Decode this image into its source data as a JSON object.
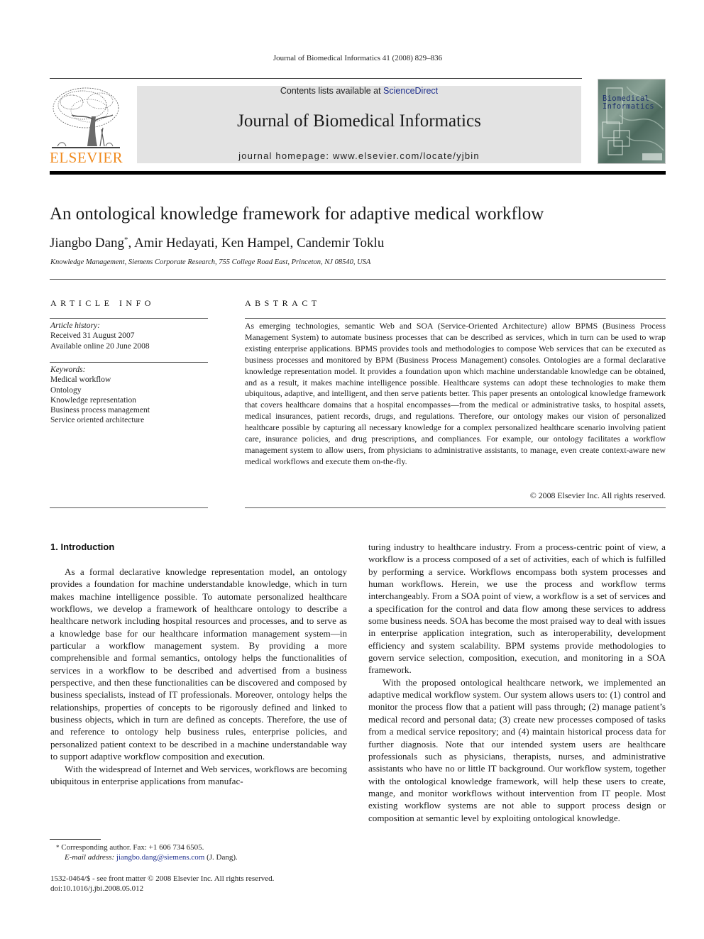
{
  "running_head": "Journal of Biomedical Informatics 41 (2008) 829–836",
  "masthead": {
    "contents_prefix": "Contents lists available at ",
    "contents_link": "ScienceDirect",
    "journal_name": "Journal of Biomedical Informatics",
    "homepage": "journal homepage: www.elsevier.com/locate/yjbin",
    "publisher_logo_text": "ELSEVIER",
    "cover_title_line1": "Biomedical",
    "cover_title_line2": "Informatics",
    "colors": {
      "publisher_orange": "#f08a1d",
      "link_blue": "#1d2e8c",
      "masthead_gray": "#e3e3e3"
    }
  },
  "article": {
    "title": "An ontological knowledge framework for adaptive medical workflow",
    "authors": "Jiangbo Dang",
    "authors_mark": "*",
    "authors_rest": ", Amir Hedayati, Ken Hampel, Candemir Toklu",
    "affiliation": "Knowledge Management, Siemens Corporate Research, 755 College Road East, Princeton, NJ 08540, USA"
  },
  "article_info": {
    "heading": "ARTICLE INFO",
    "history_label": "Article history:",
    "received": "Received 31 August 2007",
    "available": "Available online 20 June 2008",
    "keywords_label": "Keywords:",
    "keywords": [
      "Medical workflow",
      "Ontology",
      "Knowledge representation",
      "Business process management",
      "Service oriented architecture"
    ]
  },
  "abstract": {
    "heading": "ABSTRACT",
    "text": "As emerging technologies, semantic Web and SOA (Service-Oriented Architecture) allow BPMS (Business Process Management System) to automate business processes that can be described as services, which in turn can be used to wrap existing enterprise applications. BPMS provides tools and methodologies to compose Web services that can be executed as business processes and monitored by BPM (Business Process Management) consoles. Ontologies are a formal declarative knowledge representation model. It provides a foundation upon which machine understandable knowledge can be obtained, and as a result, it makes machine intelligence possible. Healthcare systems can adopt these technologies to make them ubiquitous, adaptive, and intelligent, and then serve patients better. This paper presents an ontological knowledge framework that covers healthcare domains that a hospital encompasses—from the medical or administrative tasks, to hospital assets, medical insurances, patient records, drugs, and regulations. Therefore, our ontology makes our vision of personalized healthcare possible by capturing all necessary knowledge for a complex personalized healthcare scenario involving patient care, insurance policies, and drug prescriptions, and compliances. For example, our ontology facilitates a workflow management system to allow users, from physicians to administrative assistants, to manage, even create context-aware new medical workflows and execute them on-the-fly.",
    "copyright": "© 2008 Elsevier Inc. All rights reserved."
  },
  "body": {
    "section_heading": "1. Introduction",
    "left_paragraphs": [
      "As a formal declarative knowledge representation model, an ontology provides a foundation for machine understandable knowledge, which in turn makes machine intelligence possible. To automate personalized healthcare workflows, we develop a framework of healthcare ontology to describe a healthcare network including hospital resources and processes, and to serve as a knowledge base for our healthcare information management system—in particular a workflow management system. By providing a more comprehensible and formal semantics, ontology helps the functionalities of services in a workflow to be described and advertised from a business perspective, and then these functionalities can be discovered and composed by business specialists, instead of IT professionals. Moreover, ontology helps the relationships, properties of concepts to be rigorously defined and linked to business objects, which in turn are defined as concepts. Therefore, the use of and reference to ontology help business rules, enterprise policies, and personalized patient context to be described in a machine understandable way to support adaptive workflow composition and execution.",
      "With the widespread of Internet and Web services, workflows are becoming ubiquitous in enterprise applications from manufac-"
    ],
    "right_paragraphs": [
      "turing industry to healthcare industry. From a process-centric point of view, a workflow is a process composed of a set of activities, each of which is fulfilled by performing a service. Workflows encompass both system processes and human workflows. Herein, we use the process and workflow terms interchangeably. From a SOA point of view, a workflow is a set of services and a specification for the control and data flow among these services to address some business needs. SOA has become the most praised way to deal with issues in enterprise application integration, such as interoperability, development efficiency and system scalability. BPM systems provide methodologies to govern service selection, composition, execution, and monitoring in a SOA framework.",
      "With the proposed ontological healthcare network, we implemented an adaptive medical workflow system. Our system allows users to: (1) control and monitor the process flow that a patient will pass through; (2) manage patient’s medical record and personal data; (3) create new processes composed of tasks from a medical service repository; and (4) maintain historical process data for further diagnosis. Note that our intended system users are healthcare professionals such as physicians, therapists, nurses, and administrative assistants who have no or little IT background. Our workflow system, together with the ontological knowledge framework, will help these users to create, mange, and monitor workflows without intervention from IT people. Most existing workflow systems are not able to support process design or composition at semantic level by exploiting ontological knowledge."
    ]
  },
  "footnotes": {
    "mark": "*",
    "corresponding": "Corresponding author. Fax: +1 606 734 6505.",
    "email_label": "E-mail address:",
    "email": "jiangbo.dang@siemens.com",
    "email_suffix": " (J. Dang).",
    "issn_line": "1532-0464/$ - see front matter © 2008 Elsevier Inc. All rights reserved.",
    "doi": "doi:10.1016/j.jbi.2008.05.012"
  }
}
